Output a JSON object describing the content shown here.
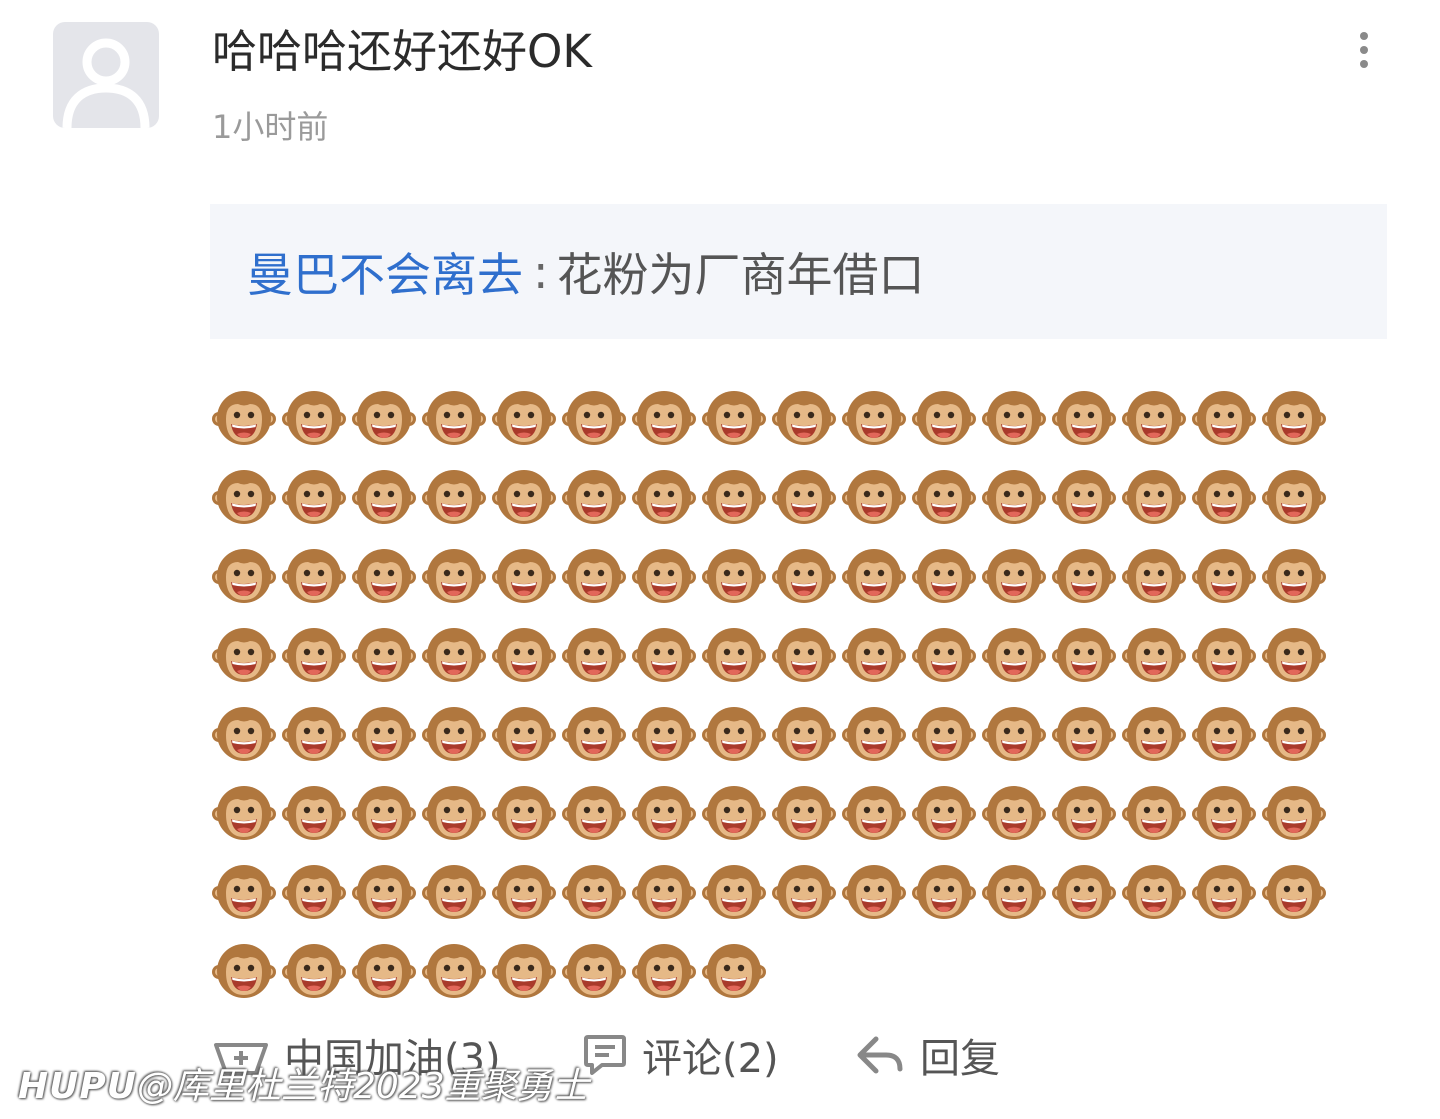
{
  "post": {
    "username": "哈哈哈还好还好OK",
    "timestamp": "1小时前"
  },
  "quote": {
    "author": "曼巴不会离去",
    "separator": ":",
    "text": "花粉为厂商年借口"
  },
  "body": {
    "emoji": "🐵",
    "emoji_icon": "monkey-face-icon",
    "emoji_count": 120
  },
  "actions": {
    "cheer_label": "中国加油(3)",
    "comment_label": "评论(2)",
    "reply_label": "回复"
  },
  "watermark": {
    "brand": "HUPU",
    "text": "@库里杜兰特2023重聚勇士"
  },
  "colors": {
    "link": "#2f6fcd",
    "quote_bg": "#f4f6fa",
    "meta": "#9a9a9a"
  }
}
